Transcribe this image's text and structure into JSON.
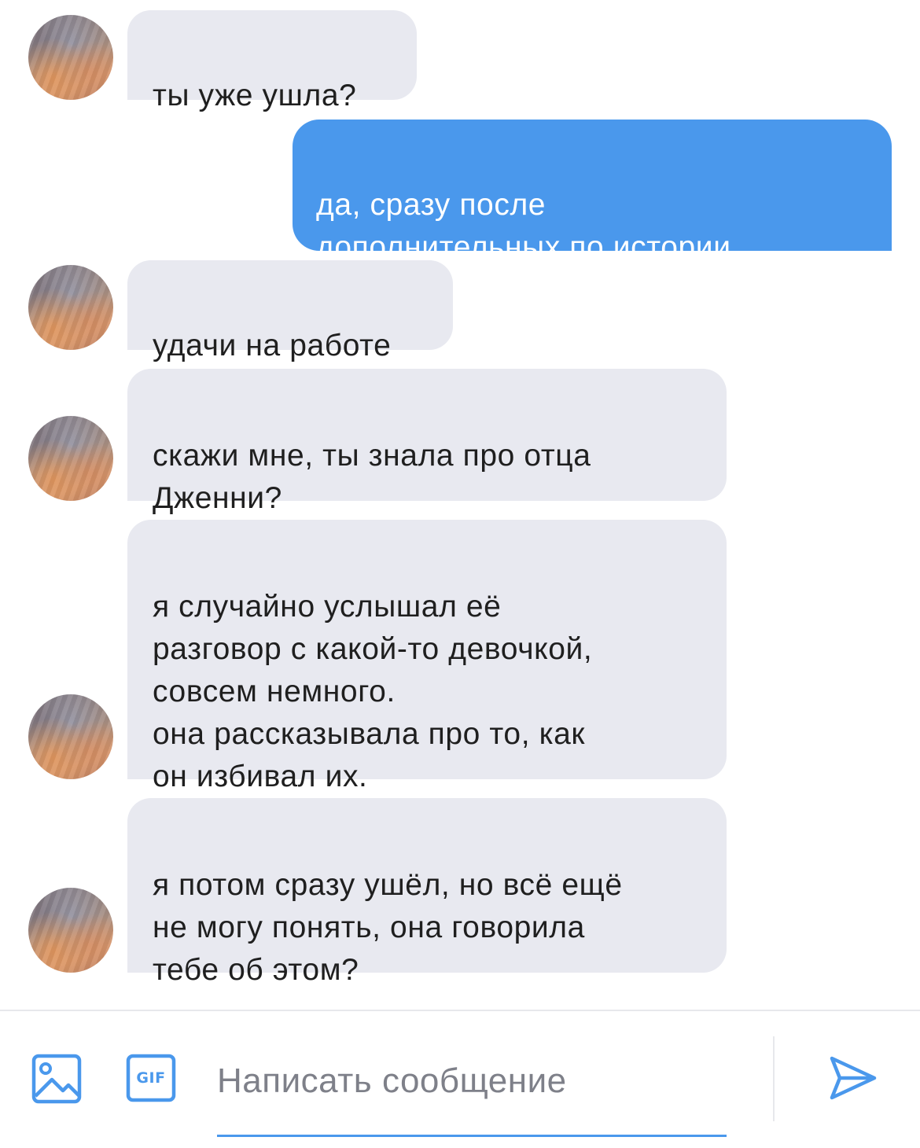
{
  "messages": [
    {
      "direction": "in",
      "text": "ты уже ушла?"
    },
    {
      "direction": "out",
      "text": "да, сразу после\nдополнительных по истории"
    },
    {
      "direction": "in",
      "text": "удачи на работе"
    },
    {
      "direction": "in",
      "text": "скажи мне, ты знала про отца\nДженни?"
    },
    {
      "direction": "in",
      "text": "я случайно услышал её\nразговор с какой-то девочкой,\nсовсем немного.\nона рассказывала про то, как\nон избивал их."
    },
    {
      "direction": "in",
      "text": "я потом сразу ушёл, но всё ещё\nне могу понять, она говорила\nтебе об этом?"
    }
  ],
  "composer": {
    "placeholder": "Написать сообщение",
    "gif_label": "GIF",
    "image_icon": "image-icon",
    "send_icon": "send-icon"
  },
  "colors": {
    "incoming_bubble": "#e8e9f0",
    "outgoing_bubble": "#4a98ec",
    "accent": "#4a98ec",
    "placeholder_text": "#7e8089"
  }
}
